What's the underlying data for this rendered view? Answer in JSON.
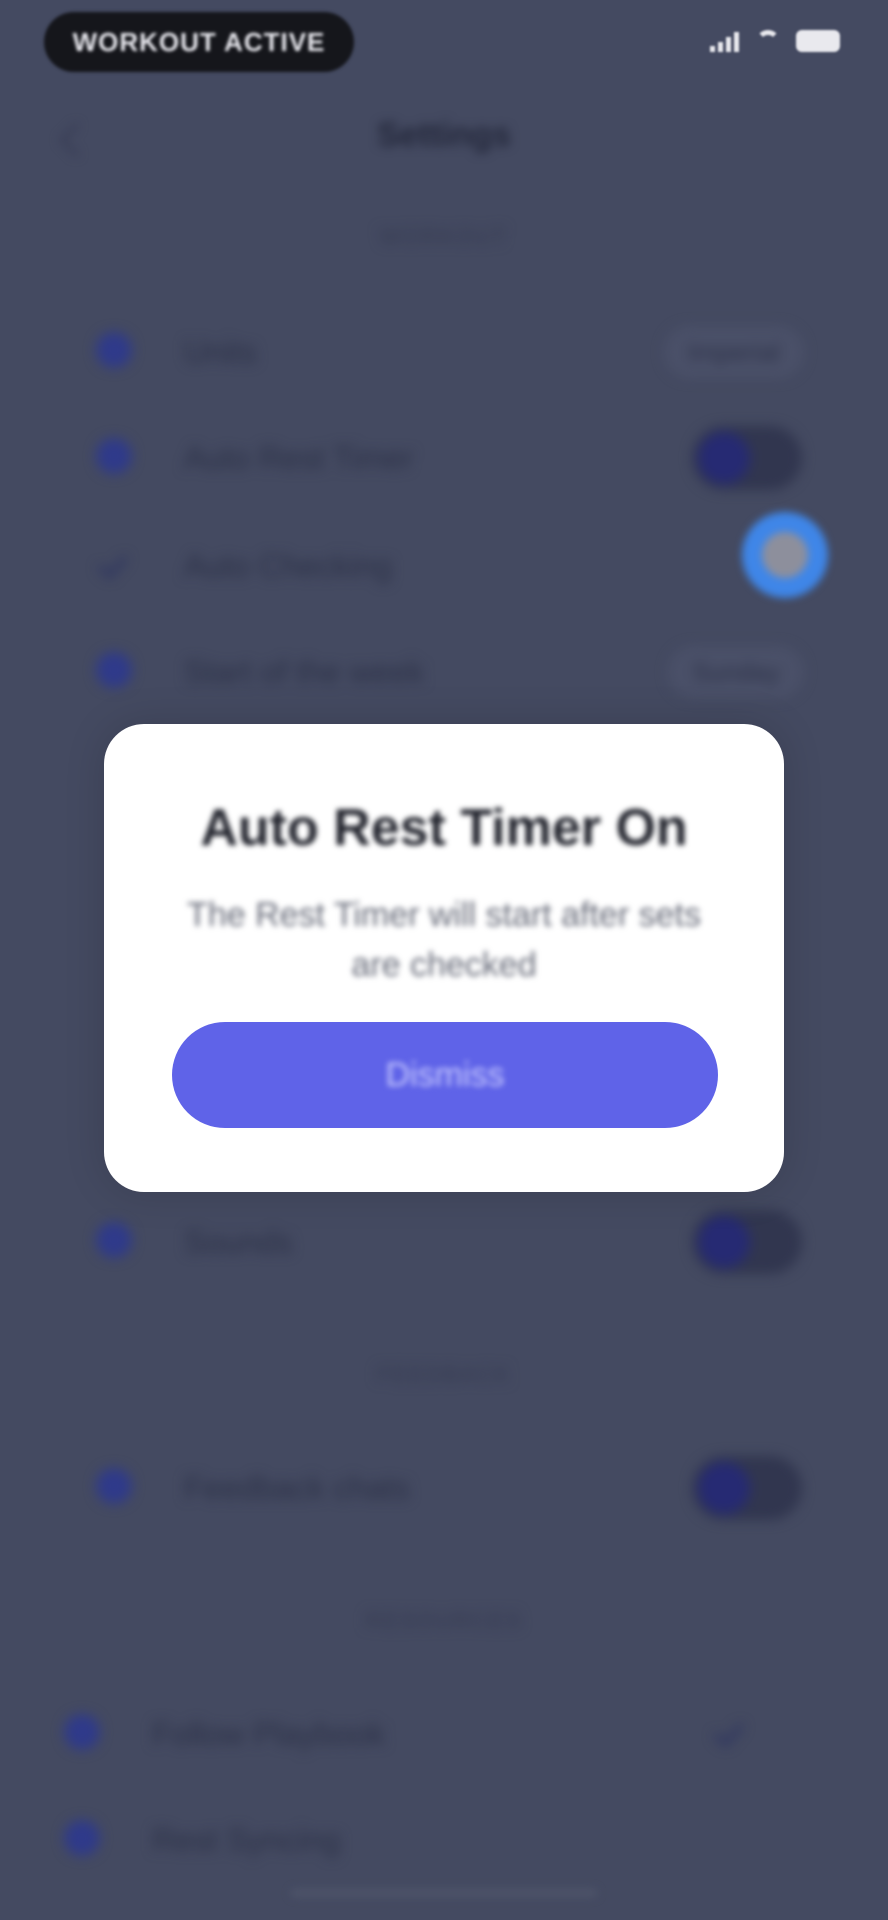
{
  "status_bar": {
    "pill_text": "WORKOUT ACTIVE"
  },
  "header": {
    "title": "Settings"
  },
  "sections": [
    {
      "label": "Workout"
    },
    {
      "label": "Feedback"
    },
    {
      "label": "Resources"
    }
  ],
  "settings_rows": [
    {
      "label": "Units",
      "value": "Imperial"
    },
    {
      "label": "Auto Rest Timer"
    },
    {
      "label": "Auto Checking"
    },
    {
      "label": "Start of the week",
      "value": "Sunday"
    },
    {
      "label": "Sounds"
    },
    {
      "label": "Feedback chats"
    },
    {
      "label": "Follow Playbook"
    },
    {
      "label": "Rest Syncing"
    }
  ],
  "modal": {
    "title": "Auto Rest Timer On",
    "body": "The Rest Timer will start after sets are checked",
    "button_label": "Dismiss"
  },
  "colors": {
    "overlay_background": "#444a61",
    "modal_background": "#ffffff",
    "primary_button": "#5f63e8",
    "focus_highlight": "#3f86e8"
  }
}
